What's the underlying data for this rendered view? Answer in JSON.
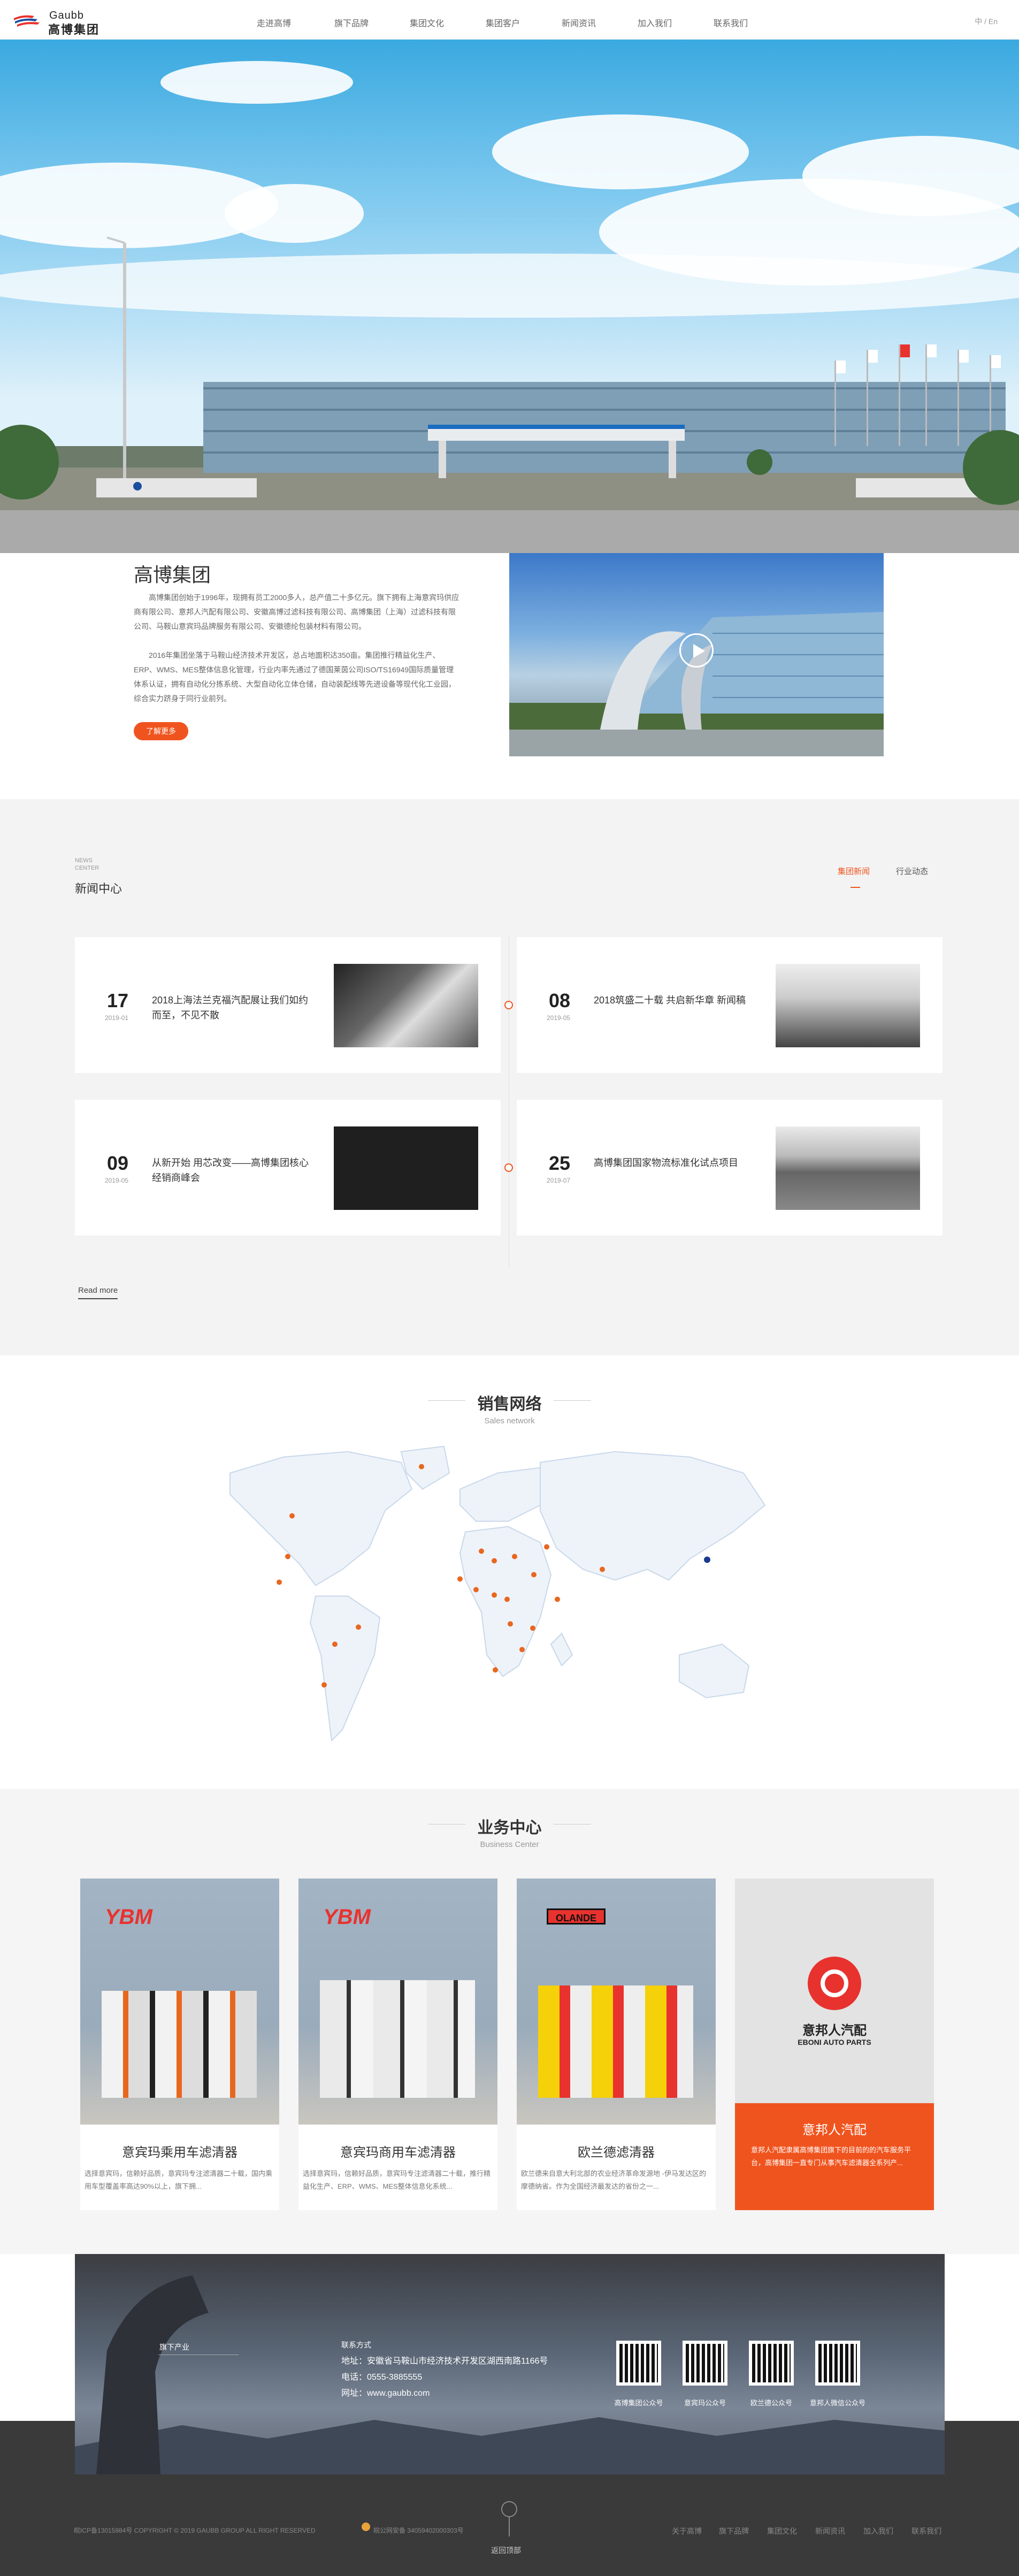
{
  "brand": {
    "latin": "Gaubb",
    "chinese": "高博集团"
  },
  "nav": {
    "items": [
      "走进高博",
      "旗下品牌",
      "集团文化",
      "集团客户",
      "新闻资讯",
      "加入我们",
      "联系我们"
    ],
    "lang": "中 / En"
  },
  "about": {
    "title": "高博集团",
    "para1": "高博集团创始于1996年，现拥有员工2000多人，总产值二十多亿元。旗下拥有上海意宾玛供应商有限公司、意邦人汽配有限公司、安徽高博过滤科技有限公司、高博集团（上海）过滤科技有限公司、马鞍山意宾玛品牌服务有限公司、安徽德纶包装材料有限公司。",
    "para2": "2016年集团坐落于马鞍山经济技术开发区，总占地面积达350亩。集团推行精益化生产、ERP、WMS、MES整体信息化管理，行业内率先通过了德国莱茵公司ISO/TS16949国际质量管理体系认证，拥有自动化分拣系统、大型自动化立体仓储，自动装配线等先进设备等现代化工业园，综合实力跻身于同行业前列。",
    "button": "了解更多"
  },
  "news": {
    "en": "NEWS CENTER",
    "title": "新闻中心",
    "tabs": [
      "集团新闻",
      "行业动态"
    ],
    "items": [
      {
        "day": "17",
        "ym": "2019-01",
        "title": "2018上海法兰克福汽配展让我们如约而至，不见不散"
      },
      {
        "day": "08",
        "ym": "2019-05",
        "title": "2018筑盛二十载 共启新华章 新闻稿"
      },
      {
        "day": "09",
        "ym": "2019-05",
        "title": "从新开始 用芯改变——高博集团核心经销商峰会"
      },
      {
        "day": "25",
        "ym": "2019-07",
        "title": "高博集团国家物流标准化试点项目"
      }
    ],
    "more": "Read more"
  },
  "sales": {
    "title": "销售网络",
    "subtitle": "Sales network"
  },
  "biz": {
    "title": "业务中心",
    "subtitle": "Business Center",
    "cards": [
      {
        "logo": "YBM",
        "name": "意宾玛乘用车滤清器",
        "desc": "选择意宾玛，信赖好品质，意宾玛专注滤清器二十载，国内乘用车型覆盖率高达90%以上，旗下拥..."
      },
      {
        "logo": "YBM",
        "name": "意宾玛商用车滤清器",
        "desc": "选择意宾玛，信赖好品质，意宾玛专注滤清器二十载，推行精益化生产、ERP、WMS、MES整体信息化系统..."
      },
      {
        "logo": "OLANDE",
        "name": "欧兰德滤清器",
        "desc": "欧兰德来自意大利北部的农业经济革命发源地 -伊马发达区的摩德纳省。作为全国经济最发达的省份之一..."
      },
      {
        "logo": "EBONI",
        "logo_cn": "意邦人汽配",
        "logo_en": "EBONI AUTO PARTS",
        "name": "意邦人汽配",
        "desc": "意邦人汽配隶属高博集团旗下的目前的的汽车服务平台，高博集团一直专门从事汽车滤清器全系列产..."
      }
    ]
  },
  "contact": {
    "brands_label": "旗下产业",
    "title": "联系方式",
    "address": "地址：安徽省马鞍山市经济技术开发区湖西南路1166号",
    "phone": "电话：0555-3885555",
    "web": "网址：www.gaubb.com",
    "qrs": [
      "高博集团公众号",
      "意宾玛公众号",
      "欧兰德公众号",
      "意邦人微信公众号"
    ]
  },
  "footer": {
    "copyright": "皖ICP备13015984号  COPYRIGHT © 2019 GAUBB GROUP ALL RIGHT RESERVED",
    "police": "皖公网安备 34059402000303号",
    "top": "返回顶部",
    "links": [
      "关于高博",
      "旗下品牌",
      "集团文化",
      "新闻资讯",
      "加入我们",
      "联系我们"
    ]
  },
  "colors": {
    "accent": "#f0541e",
    "dark": "#3a3a3a",
    "map_dot": "#e8671f",
    "map_dot_hq": "#1b3c8c"
  }
}
